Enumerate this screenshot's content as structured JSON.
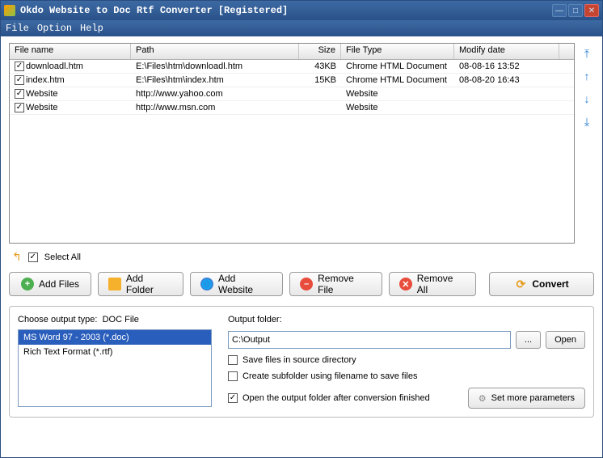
{
  "window": {
    "title": "Okdo Website to Doc Rtf Converter [Registered]"
  },
  "menu": {
    "file": "File",
    "option": "Option",
    "help": "Help"
  },
  "table": {
    "headers": {
      "name": "File name",
      "path": "Path",
      "size": "Size",
      "type": "File Type",
      "date": "Modify date"
    },
    "rows": [
      {
        "name": "downloadl.htm",
        "path": "E:\\Files\\htm\\downloadl.htm",
        "size": "43KB",
        "type": "Chrome HTML Document",
        "date": "08-08-16 13:52"
      },
      {
        "name": "index.htm",
        "path": "E:\\Files\\htm\\index.htm",
        "size": "15KB",
        "type": "Chrome HTML Document",
        "date": "08-08-20 16:43"
      },
      {
        "name": "Website",
        "path": "http://www.yahoo.com",
        "size": "",
        "type": "Website",
        "date": ""
      },
      {
        "name": "Website",
        "path": "http://www.msn.com",
        "size": "",
        "type": "Website",
        "date": ""
      }
    ]
  },
  "selectAll": "Select All",
  "buttons": {
    "addFiles": "Add Files",
    "addFolder": "Add Folder",
    "addWebsite": "Add Website",
    "removeFile": "Remove File",
    "removeAll": "Remove All",
    "convert": "Convert"
  },
  "output": {
    "chooseLabel": "Choose output type:",
    "chooseValue": "DOC File",
    "types": [
      {
        "label": "MS Word 97 - 2003 (*.doc)",
        "selected": true
      },
      {
        "label": "Rich Text Format (*.rtf)",
        "selected": false
      }
    ],
    "folderLabel": "Output folder:",
    "folderValue": "C:\\Output",
    "browse": "...",
    "open": "Open",
    "opt1": "Save files in source directory",
    "opt2": "Create subfolder using filename to save files",
    "opt3": "Open the output folder after conversion finished",
    "params": "Set more parameters"
  }
}
